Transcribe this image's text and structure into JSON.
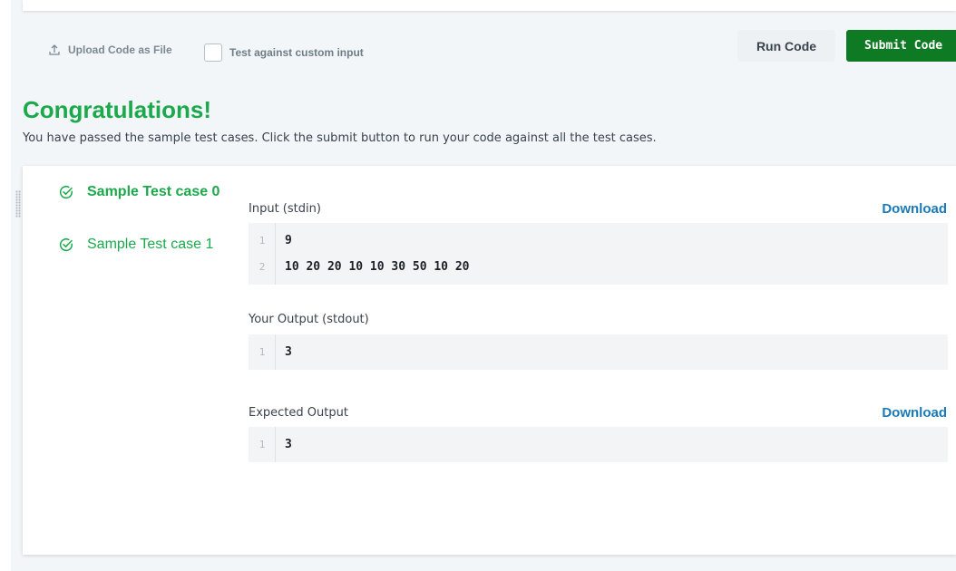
{
  "toolbar": {
    "upload_label": "Upload Code as File",
    "custom_input_label": "Test against custom input",
    "custom_input_checked": false,
    "run_label": "Run Code",
    "submit_label": "Submit Code"
  },
  "result": {
    "title": "Congratulations!",
    "message": "You have passed the sample test cases. Click the submit button to run your code against all the test cases."
  },
  "test_cases": [
    {
      "label": "Sample Test case 0",
      "status": "passed",
      "active": true
    },
    {
      "label": "Sample Test case 1",
      "status": "passed",
      "active": false
    }
  ],
  "details": {
    "input": {
      "label": "Input (stdin)",
      "download_label": "Download",
      "lines": [
        {
          "num": "1",
          "text": "9"
        },
        {
          "num": "2",
          "text": "10 20 20 10 10 30 50 10 20"
        }
      ]
    },
    "output": {
      "label": "Your Output (stdout)",
      "lines": [
        {
          "num": "1",
          "text": "3"
        }
      ]
    },
    "expected": {
      "label": "Expected Output",
      "download_label": "Download",
      "lines": [
        {
          "num": "1",
          "text": "3"
        }
      ]
    }
  },
  "colors": {
    "success": "#1ba94c",
    "submit_bg": "#0e7a23",
    "link": "#1a7ab8",
    "text": "#39424e"
  },
  "icons": {
    "upload": "upload-icon",
    "check": "check-circle-icon",
    "grip": "drag-handle-icon"
  }
}
